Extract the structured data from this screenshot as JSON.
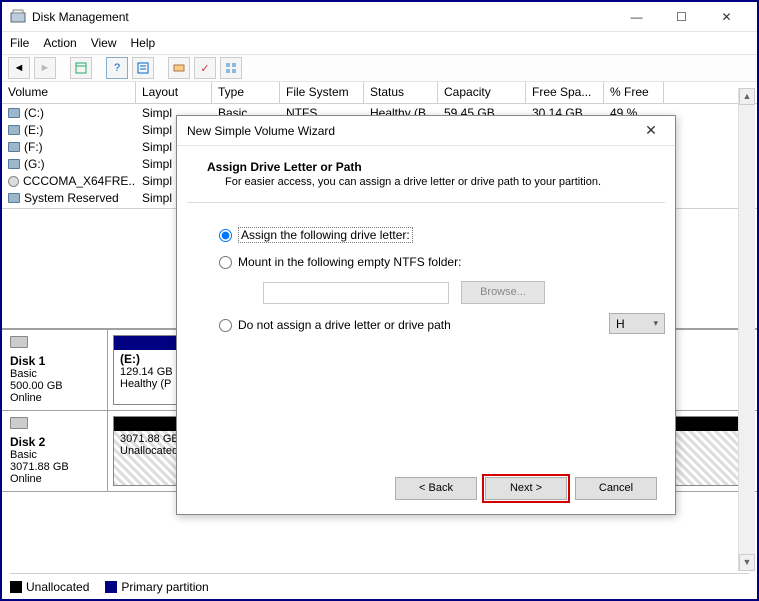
{
  "window": {
    "title": "Disk Management",
    "min": "—",
    "max": "☐",
    "close": "✕"
  },
  "menu": {
    "file": "File",
    "action": "Action",
    "view": "View",
    "help": "Help"
  },
  "columns": {
    "volume": "Volume",
    "layout": "Layout",
    "type": "Type",
    "fs": "File System",
    "status": "Status",
    "capacity": "Capacity",
    "free": "Free Spa...",
    "pfree": "% Free"
  },
  "volumes": [
    {
      "name": "(C:)",
      "layout": "Simpl",
      "icon": "vol"
    },
    {
      "name": "(E:)",
      "layout": "Simpl",
      "icon": "vol"
    },
    {
      "name": "(F:)",
      "layout": "Simpl",
      "icon": "vol"
    },
    {
      "name": "(G:)",
      "layout": "Simpl",
      "icon": "vol"
    },
    {
      "name": "CCCOMA_X64FRE...",
      "layout": "Simpl",
      "icon": "disc"
    },
    {
      "name": "System Reserved",
      "layout": "Simpl",
      "icon": "vol"
    }
  ],
  "row0_extra": {
    "type": "Basic",
    "fs": "NTFS",
    "status": "Healthy (B",
    "cap": "59.45 GB",
    "free": "30.14 GB",
    "pfree": "49 %"
  },
  "disks": [
    {
      "title": "Disk 1",
      "type": "Basic",
      "size": "500.00 GB",
      "state": "Online",
      "parts": [
        {
          "kind": "primary",
          "label": "(E:)",
          "size": "129.14 GB",
          "status": "Healthy (P"
        }
      ]
    },
    {
      "title": "Disk 2",
      "type": "Basic",
      "size": "3071.88 GB",
      "state": "Online",
      "parts": [
        {
          "kind": "unalloc",
          "label": "",
          "size": "3071.88 GB",
          "status": "Unallocated"
        }
      ]
    }
  ],
  "legend": {
    "unallocated": "Unallocated",
    "primary": "Primary partition"
  },
  "wizard": {
    "title": "New Simple Volume Wizard",
    "heading": "Assign Drive Letter or Path",
    "sub": "For easier access, you can assign a drive letter or drive path to your partition.",
    "opt_assign": "Assign the following drive letter:",
    "drive_letter": "H",
    "opt_mount": "Mount in the following empty NTFS folder:",
    "browse": "Browse...",
    "opt_none": "Do not assign a drive letter or drive path",
    "back": "< Back",
    "next": "Next >",
    "cancel": "Cancel"
  }
}
